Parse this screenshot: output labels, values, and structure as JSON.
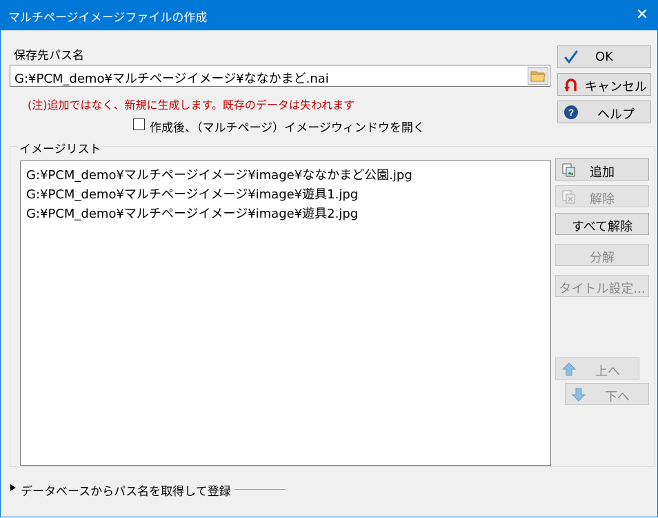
{
  "window": {
    "title": "マルチページイメージファイルの作成",
    "close_glyph": "✕"
  },
  "save_path": {
    "label": "保存先パス名",
    "value": "G:¥PCM_demo¥マルチページイメージ¥ななかまど.nai",
    "note": "(注)追加ではなく、新規に生成します。既存のデータは失われます"
  },
  "open_after": {
    "label": "作成後、（マルチページ）イメージウィンドウを開く",
    "checked": false
  },
  "buttons": {
    "ok": "OK",
    "cancel": "キャンセル",
    "help": "ヘルプ"
  },
  "image_list": {
    "label": "イメージリスト",
    "items": [
      "G:¥PCM_demo¥マルチページイメージ¥image¥ななかまど公園.jpg",
      "G:¥PCM_demo¥マルチページイメージ¥image¥遊具1.jpg",
      "G:¥PCM_demo¥マルチページイメージ¥image¥遊具2.jpg"
    ]
  },
  "list_buttons": {
    "add": "追加",
    "remove": "解除",
    "remove_all": "すべて解除",
    "split": "分解",
    "title_setting": "タイトル設定...",
    "up": "上へ",
    "down": "下へ"
  },
  "database_expander": {
    "label": "データベースからパス名を取得して登録"
  },
  "colors": {
    "titlebar": "#0078d7",
    "note": "#c00000",
    "accent": "#1a5fb4"
  }
}
